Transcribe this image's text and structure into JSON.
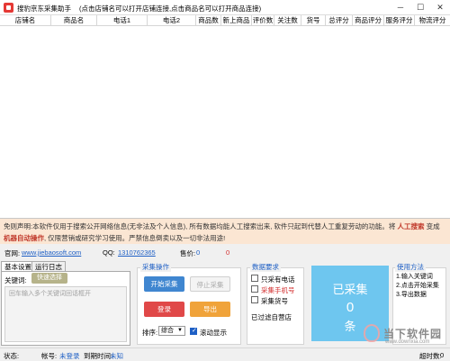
{
  "window": {
    "title": "搜豹京东采集助手",
    "hint": "(点击店铺名可以打开店铺连接,点击商品名可以打开商品连接)",
    "minimize_glyph": "─",
    "maximize_glyph": "☐",
    "close_glyph": "✕"
  },
  "table": {
    "columns": [
      "店铺名",
      "商品名",
      "电话1",
      "电话2",
      "商品数",
      "新上商品",
      "评价数",
      "关注数",
      "货号",
      "总评分",
      "商品评分",
      "服务评分",
      "物流评分"
    ]
  },
  "disclaimer": {
    "part1": "免则声明:本软件仅用于搜索公开网络信息(无非法及个人信息), 所有数据均能人工搜索出来, 软件只起到代替人工重复劳动的功能。将 ",
    "highlight1": "人工搜索",
    "part2": " 变成 ",
    "highlight2": "机器自动操作",
    "part3": ", 仅限营销或研究学习使用。严禁信息倒卖以及一切非法用途!"
  },
  "info": {
    "website_label": "官网:",
    "website": "www.jiebaosoft.com",
    "qq_label": "QQ:",
    "qq": "1310762365",
    "version_label": "售价:",
    "version_value": "0",
    "price_value": "0"
  },
  "tabs": [
    "基本设置",
    "运行日志"
  ],
  "keyword": {
    "label": "关键词:",
    "quick_button": "快速选择",
    "placeholder": "回车输入多个关键词回话框开"
  },
  "collect_ops": {
    "title": "采集操作",
    "start": "开始采集",
    "stop": "停止采集",
    "login": "登录",
    "export": "导出",
    "sort_label": "排序:",
    "sort_value": "综合",
    "scroll_label": "滚动显示"
  },
  "data_req": {
    "title": "数据要求",
    "opt1": "只采有电话",
    "opt2": "采集手机号",
    "opt3": "采集货号",
    "filtered": "已过滤自营店"
  },
  "counter": {
    "label": "已采集",
    "count": "0",
    "unit": "条"
  },
  "usage": {
    "title": "使用方法",
    "step1": "1.输入关键词",
    "step2": "2.点击开始采集",
    "step3": "3.导出数据"
  },
  "status": {
    "state_label": "状态:",
    "account_label": "帐号:",
    "account_value": "未登录",
    "expire_label": "到期时间:",
    "expire_value": "未知",
    "timeout_label": "超时数:",
    "timeout_value": "0"
  },
  "watermark": {
    "name": "当下软件园",
    "url": "www.downxia.com"
  },
  "colors": {
    "start_button": "#3f86d0",
    "login_button": "#e04848",
    "export_button": "#f0a33a",
    "counter_bg": "#6ec6ef",
    "disclaimer_bg": "#fbe6d3"
  }
}
